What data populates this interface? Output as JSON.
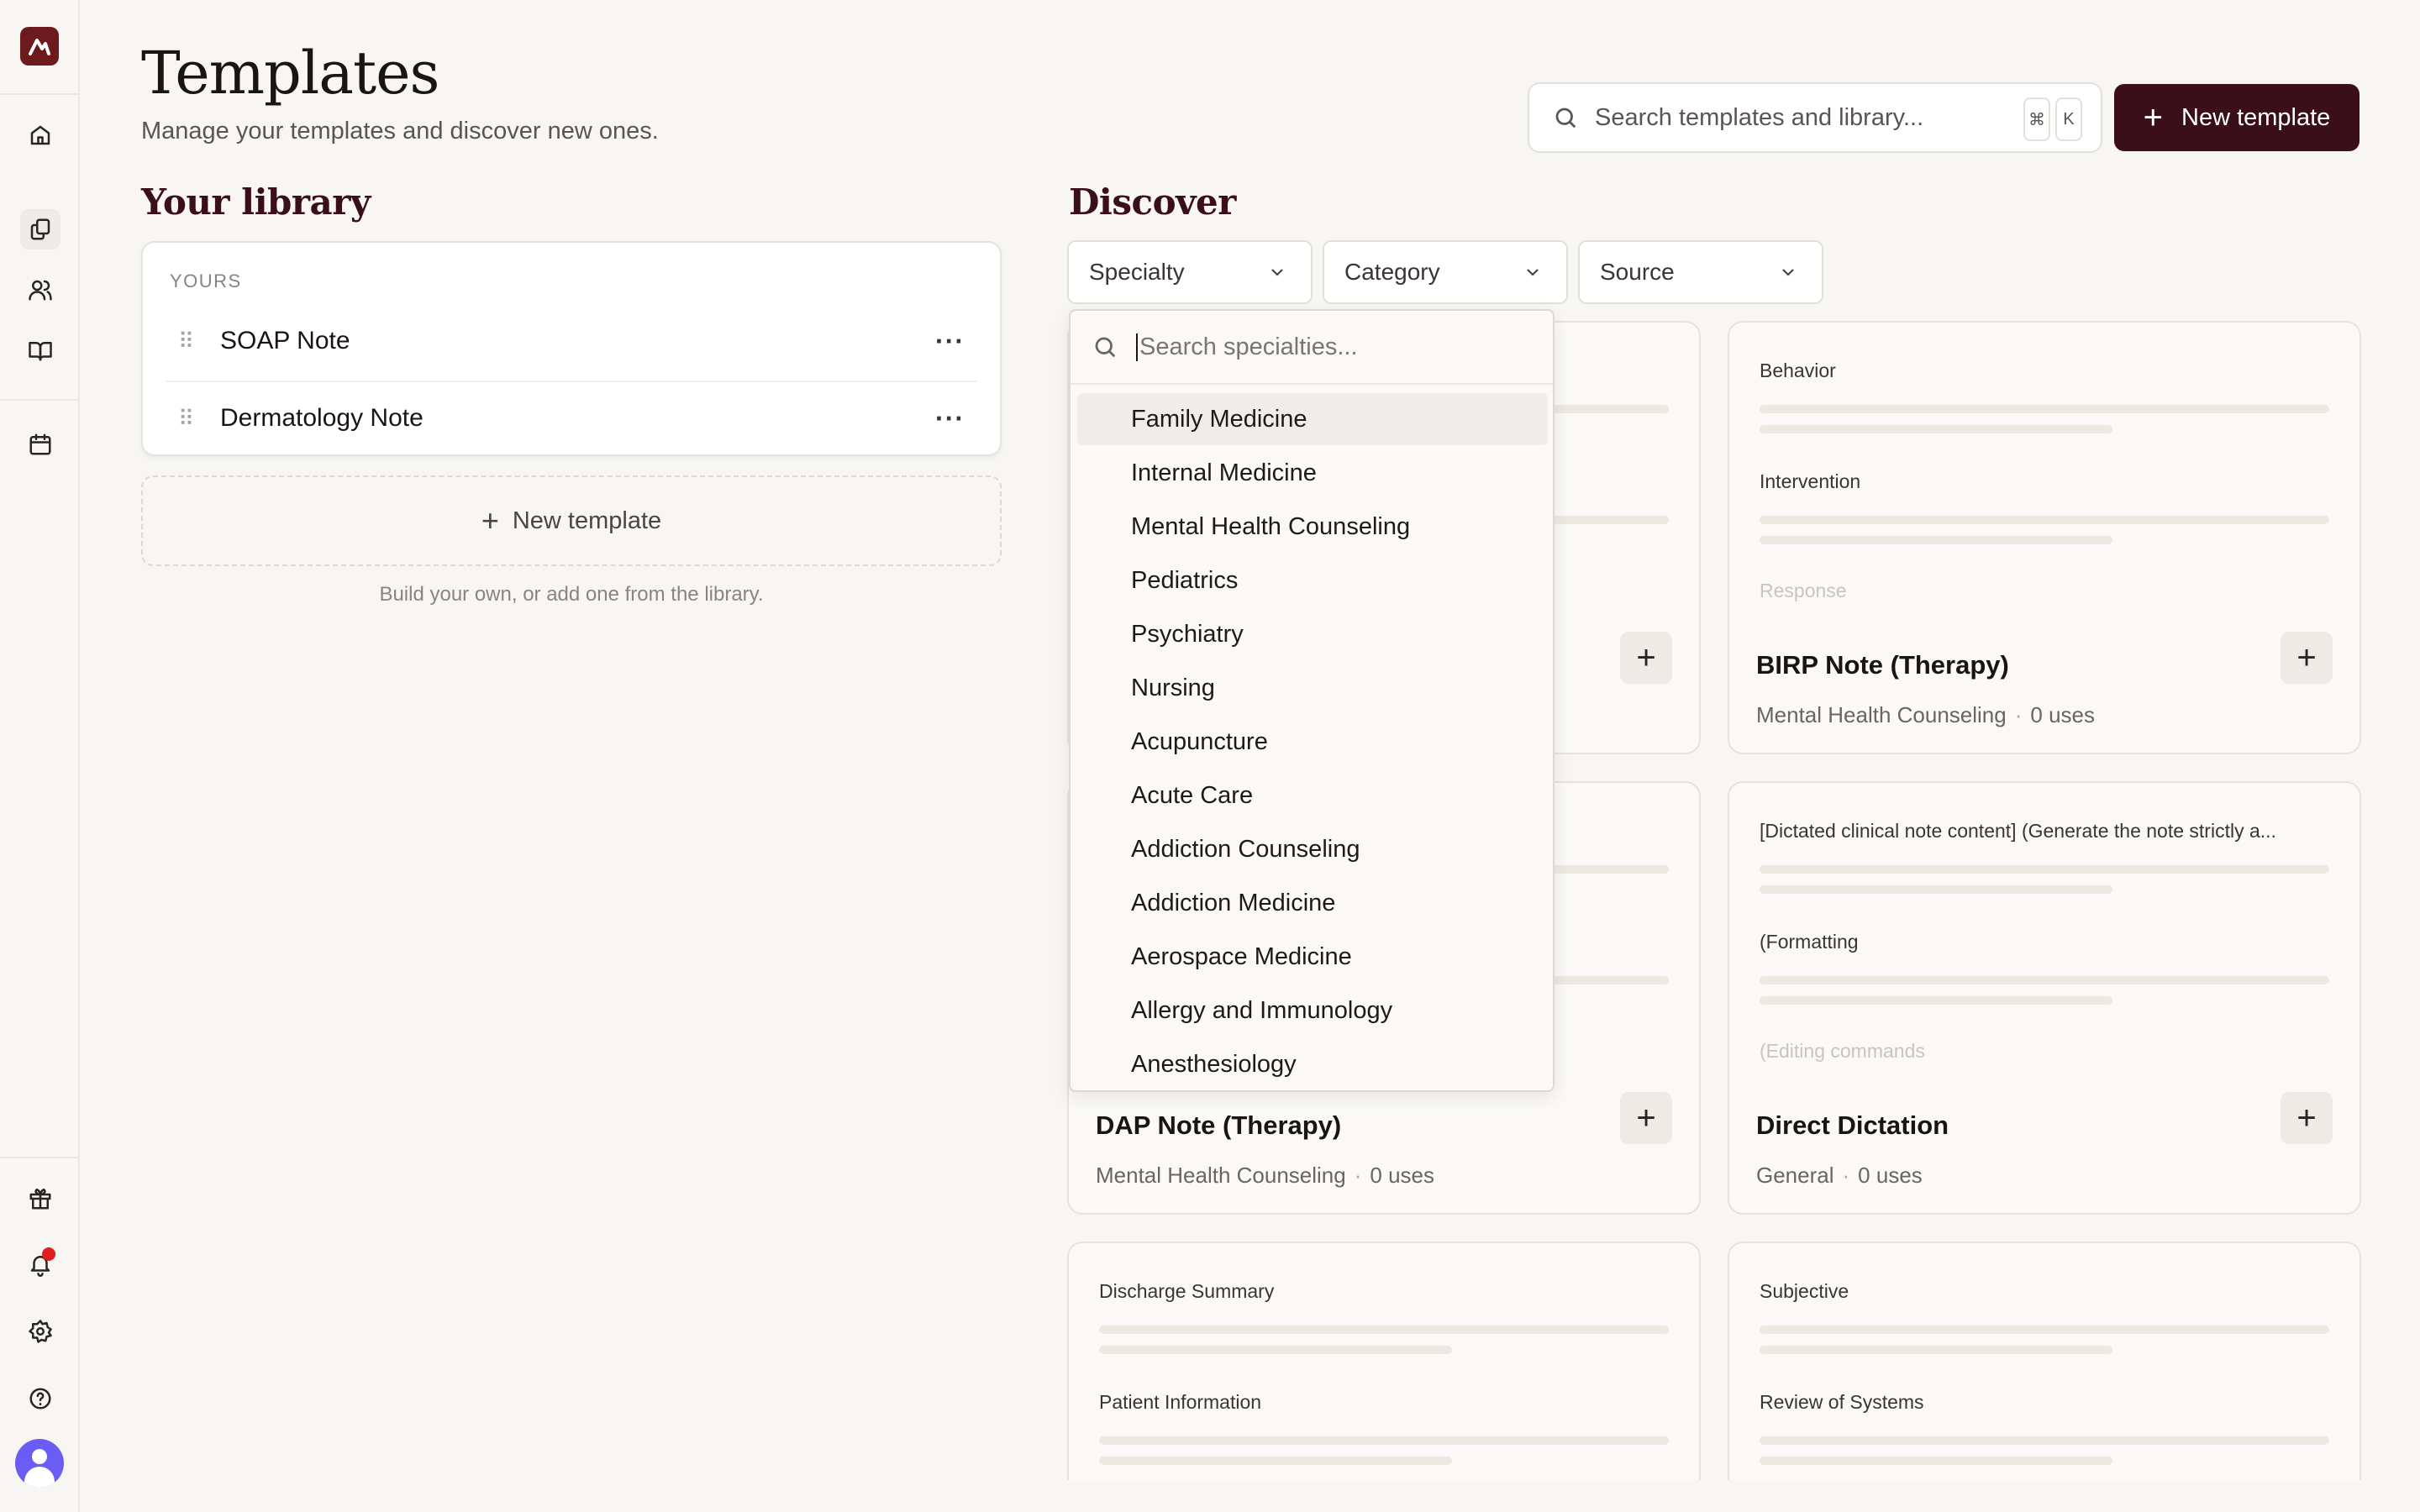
{
  "sidebar": {
    "top_icons": [
      "home-icon",
      "templates-icon",
      "patients-icon",
      "library-book-icon",
      "calendar-icon"
    ],
    "bottom_icons": [
      "gift-icon",
      "bell-icon",
      "settings-icon",
      "help-icon"
    ],
    "active": "templates-icon"
  },
  "header": {
    "title": "Templates",
    "subtitle": "Manage your templates and discover new ones.",
    "search_placeholder": "Search templates and library...",
    "shortcut_keys": [
      "⌘",
      "K"
    ],
    "new_button": "New template"
  },
  "library": {
    "title": "Your library",
    "group_label": "YOURS",
    "items": [
      {
        "name": "SOAP Note"
      },
      {
        "name": "Dermatology Note"
      }
    ],
    "new_template": "New template",
    "hint": "Build your own, or add one from the library."
  },
  "discover": {
    "title": "Discover",
    "filters": [
      "Specialty",
      "Category",
      "Source"
    ],
    "cards": [
      {
        "sections": [
          "Behavior",
          "Intervention",
          "Response"
        ],
        "title": "BIRP Note (Therapy)",
        "specialty": "Mental Health Counseling",
        "uses": "0 uses"
      },
      {
        "sections": [],
        "title": "DAP Note (Therapy)",
        "specialty": "Mental Health Counseling",
        "uses": "0 uses"
      },
      {
        "sections": [
          "[Dictated clinical note content] (Generate the note strictly a...",
          "(Formatting",
          "(Editing commands"
        ],
        "title": "Direct Dictation",
        "specialty": "General",
        "uses": "0 uses"
      },
      {
        "sections": [
          "Discharge Summary",
          "Patient Information"
        ]
      },
      {
        "sections": [
          "Subjective",
          "Review of Systems"
        ]
      }
    ]
  },
  "specialty_dropdown": {
    "search_placeholder": "Search specialties...",
    "highlighted": "Family Medicine",
    "options": [
      "Family Medicine",
      "Internal Medicine",
      "Mental Health Counseling",
      "Pediatrics",
      "Psychiatry",
      "Nursing",
      "Acupuncture",
      "Acute Care",
      "Addiction Counseling",
      "Addiction Medicine",
      "Aerospace Medicine",
      "Allergy and Immunology",
      "Anesthesiology"
    ]
  },
  "colors": {
    "brand": "#6d1a1f",
    "primary_button": "#3a0f1a",
    "notification": "#e01e1e",
    "avatar": "#6a5cf5"
  }
}
